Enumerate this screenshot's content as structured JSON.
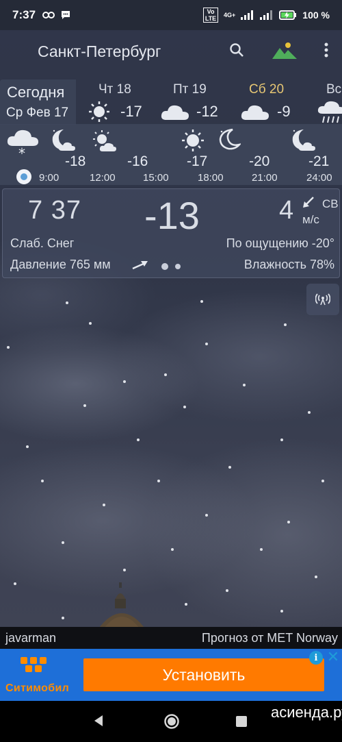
{
  "status_bar": {
    "time": "7:37",
    "network": "4G+",
    "volte": "Vo LTE",
    "battery": "100 %"
  },
  "app_bar": {
    "city": "Санкт-Петербург",
    "search_icon": "search-icon",
    "wallpaper_icon": "landscape-icon",
    "menu_icon": "more-vert-icon"
  },
  "days": {
    "today": {
      "label": "Сегодня",
      "date": "Ср Фев 17"
    },
    "items": [
      {
        "name": "Чт 18",
        "temp": "-17",
        "icon": "sun-icon"
      },
      {
        "name": "Пт 19",
        "temp": "-12",
        "icon": "cloud-icon"
      },
      {
        "name": "Сб 20",
        "temp": "-9",
        "icon": "cloud-icon"
      },
      {
        "name": "Вс",
        "temp": "",
        "icon": "rain-cloud-icon"
      }
    ]
  },
  "hourly": [
    {
      "time": "9:00",
      "temp": "",
      "icon": "snow-cloud-icon"
    },
    {
      "time": "12:00",
      "temp": "-18",
      "icon": "moon-cloud-icon"
    },
    {
      "time": "15:00",
      "temp": "-16",
      "icon": "sun-cloud-icon"
    },
    {
      "time": "18:00",
      "temp": "-17",
      "icon": "sun-icon"
    },
    {
      "time": "21:00",
      "temp": "-20",
      "icon": "moon-icon"
    },
    {
      "time": "24:00",
      "temp": "-21",
      "icon": "moon-cloud-icon"
    }
  ],
  "current": {
    "time": "7 37",
    "temperature": "-13",
    "wind_speed": "4",
    "wind_direction": "СВ",
    "wind_unit": "м/с",
    "condition": "Слаб. Снег",
    "feels_like": "По ощущению -20°",
    "pressure": "Давление 765 мм",
    "humidity": "Влажность 78%"
  },
  "footer": {
    "author": "javarman",
    "provider": "Прогноз от MET Norway"
  },
  "ad": {
    "brand": "Ситимобил",
    "cta": "Установить",
    "info": "i",
    "close": "✕"
  },
  "watermark": "асиенда.ру",
  "colors": {
    "accent_sat": "#e7c774",
    "ad_button": "#ff7a00",
    "ad_background": "#1e6fd8"
  }
}
